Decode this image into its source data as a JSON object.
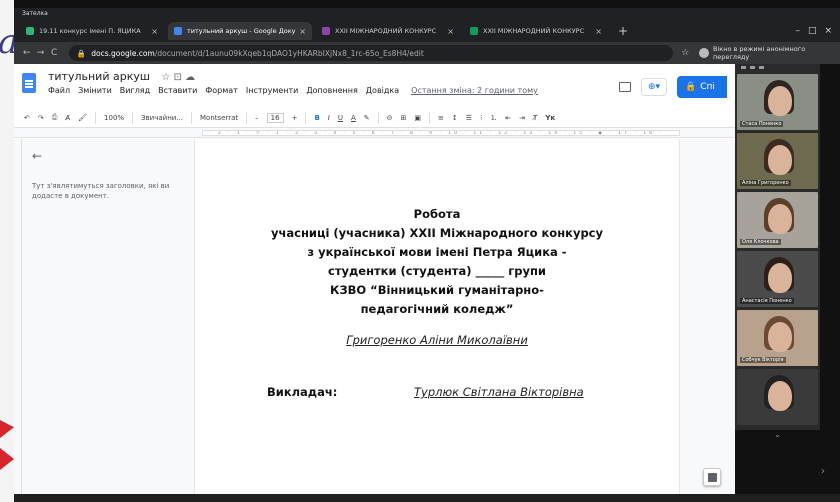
{
  "window": {
    "title": "Зателка"
  },
  "tabs": [
    {
      "label": "19.11 конкурс імені П. ЯЦИКА",
      "icon_color": "#2bb673",
      "active": false
    },
    {
      "label": "титульний аркуш - Google Доку",
      "icon_color": "#4285f4",
      "active": true
    },
    {
      "label": "ХХІІ МІЖНАРОДНИЙ КОНКУРС",
      "icon_color": "#8e44ad",
      "active": false
    },
    {
      "label": "ХХІІ МІЖНАРОДНИЙ КОНКУРС",
      "icon_color": "#0f9d58",
      "active": false
    }
  ],
  "tab_close": "×",
  "new_tab": "+",
  "window_controls": [
    "–",
    "□",
    "×"
  ],
  "address": {
    "domain": "docs.google.com",
    "path": "/document/d/1aunu09kXqeb1qDAO1yHKARbIXjNx8_1rc-65o_Es8H4/edit",
    "incognito": "Вікно в режимі анонімного перегляду"
  },
  "docs": {
    "title": "титульний аркуш",
    "title_icons": "☆ ⊡ ☁",
    "menu": [
      "Файл",
      "Змінити",
      "Вигляд",
      "Вставити",
      "Формат",
      "Інструменти",
      "Доповнення",
      "Довідка"
    ],
    "last_edit": "Остання зміна: 2 години тому",
    "share_label": "Спі"
  },
  "toolbar": {
    "zoom": "100%",
    "style": "Звичайни...",
    "font": "Montserrat",
    "size": "16",
    "minus": "–",
    "plus": "+",
    "bold": "B",
    "italic": "I",
    "underline": "U",
    "textcolor": "A",
    "edit_mode": "Yк"
  },
  "ruler": "· 2 · 1 · ▽ · 1 · 2 · 3 · 4 · 5 · 6 · 7 · 8 · 9 · 10 · 11 · 12 · 13 · 14 · 15 · ◆ · 17 · 18 ·",
  "outline": {
    "back": "←",
    "text": "Тут з'являтимуться заголовки, які ви додасте в документ."
  },
  "document": {
    "lines": [
      "Робота",
      "учасниці (учасника) ХХІІ Міжнародного конкурсу",
      "з української мови імені Петра Яцика -",
      "студентки (студента) _____ групи",
      "КЗВО “Вінницький гуманітарно-",
      "педагогічний коледж”"
    ],
    "student": "Григоренко Аліни Миколаївни",
    "teacher_label": "Викладач:",
    "teacher_name": "Турлюк Світлана Вікторівна"
  },
  "participants": [
    {
      "name": "Стаса Поненко",
      "bg": "#8a8f86",
      "hair": "#2e2420"
    },
    {
      "name": "Аліна Григоренко",
      "bg": "#6d6a4f",
      "hair": "#3a2a22"
    },
    {
      "name": "Оля Клочкова",
      "bg": "#a7a39a",
      "hair": "#5b3e2c"
    },
    {
      "name": "Анастасія Поненко",
      "bg": "#4b4b4b",
      "hair": "#2b2019"
    },
    {
      "name": "Собчук Вікторія",
      "bg": "#b8a28d",
      "hair": "#6a4a35"
    },
    {
      "name": "",
      "bg": "#3a3a3a",
      "hair": "#222"
    }
  ],
  "panel_footer": "⌄",
  "right_chevron": "›",
  "left_glyph": "a"
}
